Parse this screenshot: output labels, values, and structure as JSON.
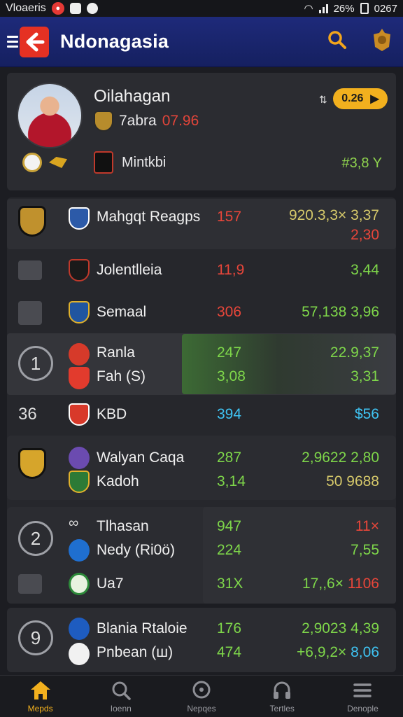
{
  "status_bar": {
    "left_text": "Vloaeris",
    "signal": "॥",
    "battery_text": "26%",
    "time": "0267"
  },
  "header": {
    "title": "Ndonagasia",
    "icons": [
      "menu-icon",
      "logo-arrow-icon",
      "search-icon",
      "crest-icon"
    ]
  },
  "profile": {
    "name": "Oilahagan",
    "sub_label": "7abra",
    "sub_value": "07.96",
    "pill_value": "0.26",
    "extra_label": "Mintkbi",
    "stat": "#3,8 Y"
  },
  "rows": [
    {
      "team": "Mahgqt Reagps",
      "v1": "157",
      "v2a": "920.3,3× 3,37",
      "v2b": "2,30"
    },
    {
      "team": "Jolentlleia",
      "v1": "11,9",
      "v2": "3,44"
    },
    {
      "team": "Semaal",
      "v1": "306",
      "v2": "57,138 3,96"
    },
    {
      "lead": "1",
      "team": "Ranla",
      "team2": "Fah (S)",
      "v1": "247",
      "v1b": "3,08",
      "v2": "22.9,37",
      "v2b": "3,31"
    },
    {
      "lead": "36",
      "team": "KBD",
      "v1": "394",
      "v2": "$56"
    }
  ],
  "card2": {
    "team": "Walyan Caqa",
    "team2": "Kadoh",
    "v1": "287",
    "v1b": "3,14",
    "v2": "2,9622 2,80",
    "v2b": "50 9688"
  },
  "card3": {
    "lead": "2",
    "team": "Tlhasan",
    "team2": "Nedy (Ri0ö)",
    "team3": "Ua7",
    "v1": "947",
    "v1b": "224",
    "v1c": "31X",
    "v2": "11×",
    "v2b": "7,55",
    "v2c_a": "17,,6×",
    "v2c_b": "1106"
  },
  "card4": {
    "lead": "9",
    "team": "Blania Rtaloie",
    "team2": "Pnbean (ш)",
    "v1": "176",
    "v1b": "474",
    "v2": "2,9023 4,39",
    "v2b_a": "+6,9,2×",
    "v2b_b": "8,06"
  },
  "bottom_nav": [
    {
      "label": "Mepds",
      "icon": "home-icon",
      "active": true
    },
    {
      "label": "Ioenn",
      "icon": "search-icon",
      "active": false
    },
    {
      "label": "Nepqes",
      "icon": "search-circle-icon",
      "active": false
    },
    {
      "label": "Tertles",
      "icon": "headset-icon",
      "active": false
    },
    {
      "label": "Denople",
      "icon": "menu-lines-icon",
      "active": false
    }
  ],
  "colors": {
    "accent": "#f2b01e",
    "positive": "#7ed64a",
    "negative": "#e8463a",
    "info": "#3fc3f2",
    "header": "#1e2a7a"
  }
}
